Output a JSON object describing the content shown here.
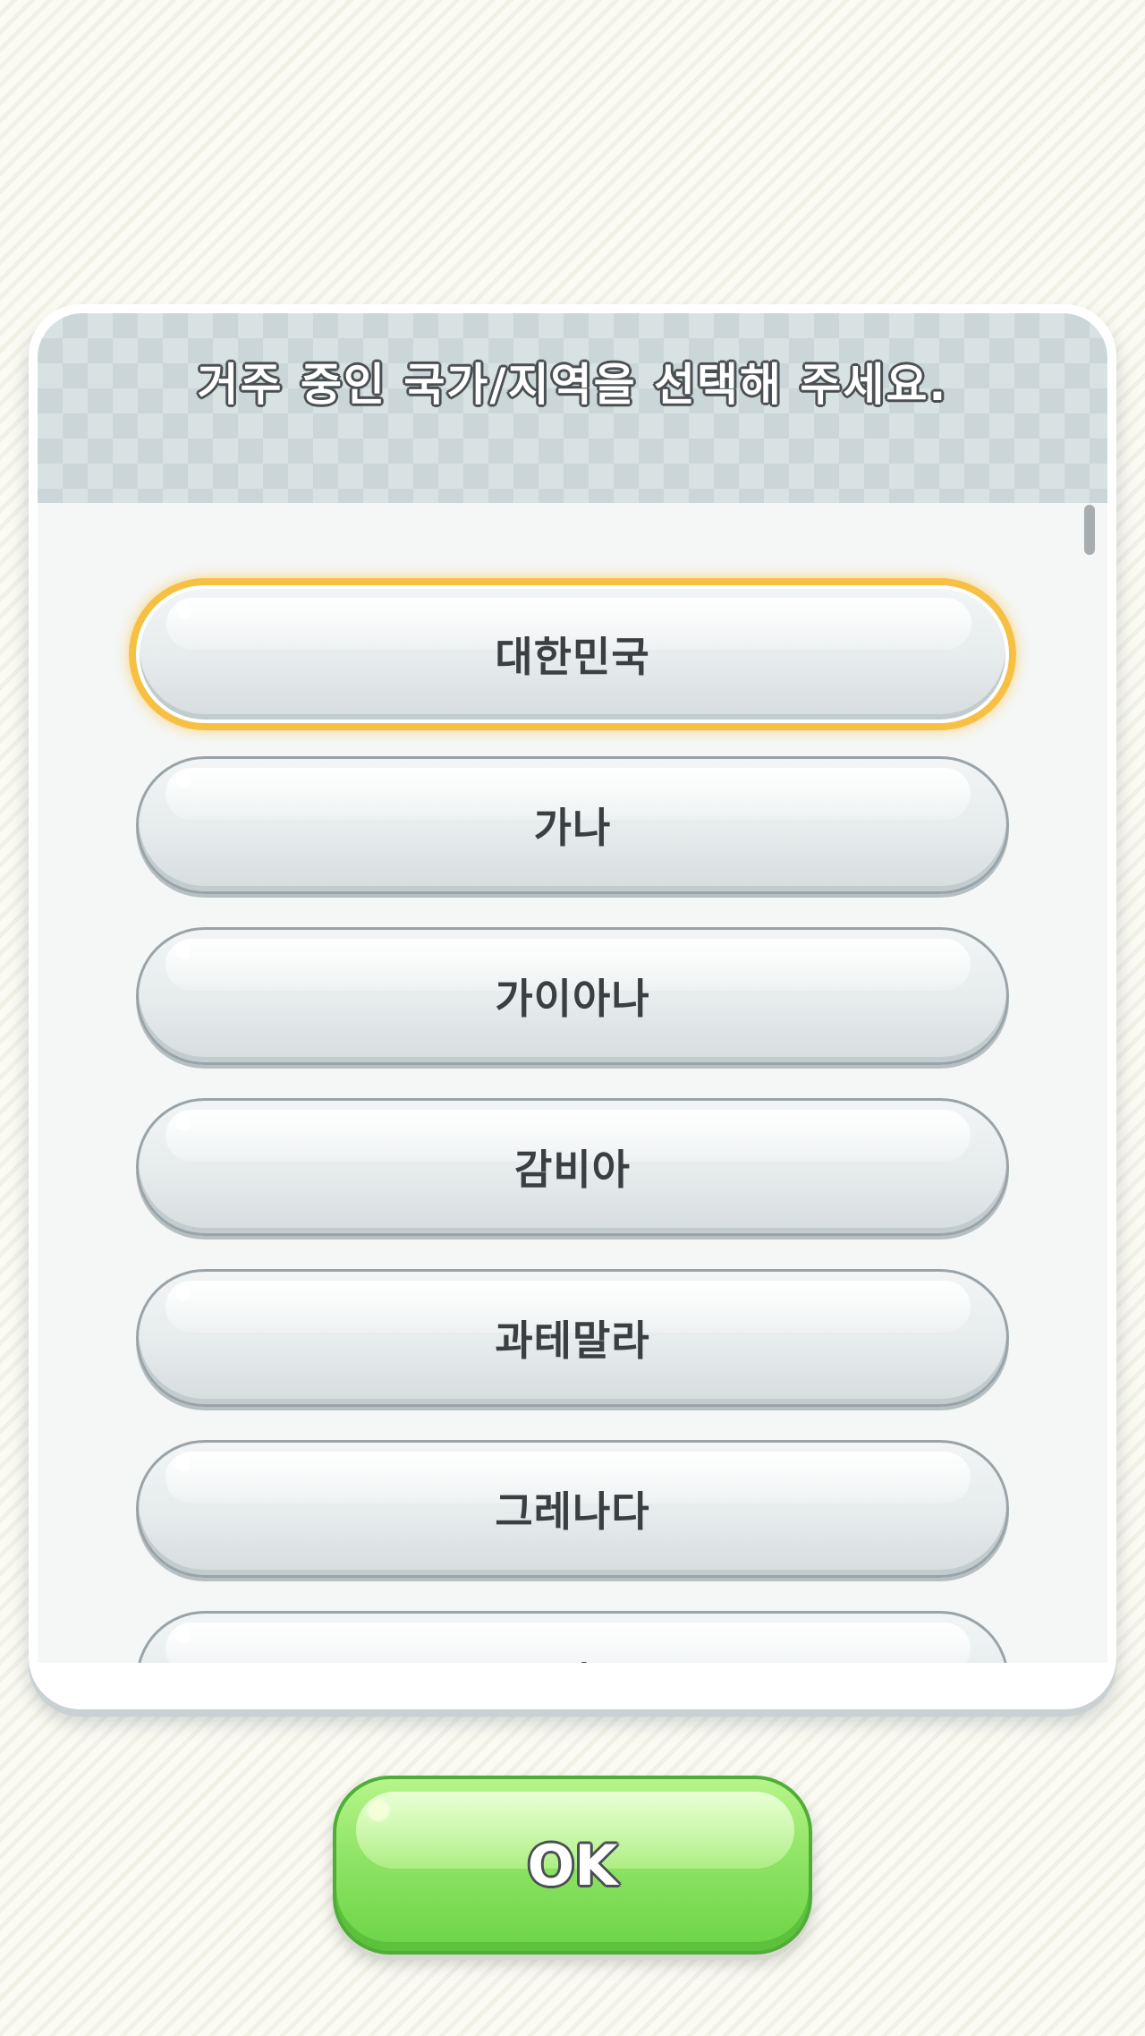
{
  "dialog": {
    "title": "거주 중인 국가/지역을 선택해 주세요."
  },
  "countries": [
    {
      "label": "대한민국",
      "selected": true
    },
    {
      "label": "가나",
      "selected": false
    },
    {
      "label": "가이아나",
      "selected": false
    },
    {
      "label": "감비아",
      "selected": false
    },
    {
      "label": "과테말라",
      "selected": false
    },
    {
      "label": "그레나다",
      "selected": false
    },
    {
      "label": "그리스",
      "selected": false
    }
  ],
  "ok_button": {
    "label": "OK"
  },
  "colors": {
    "selected_outline": "#f8c043",
    "ok_green": "#8fe465",
    "label_text": "#3b3f42"
  }
}
